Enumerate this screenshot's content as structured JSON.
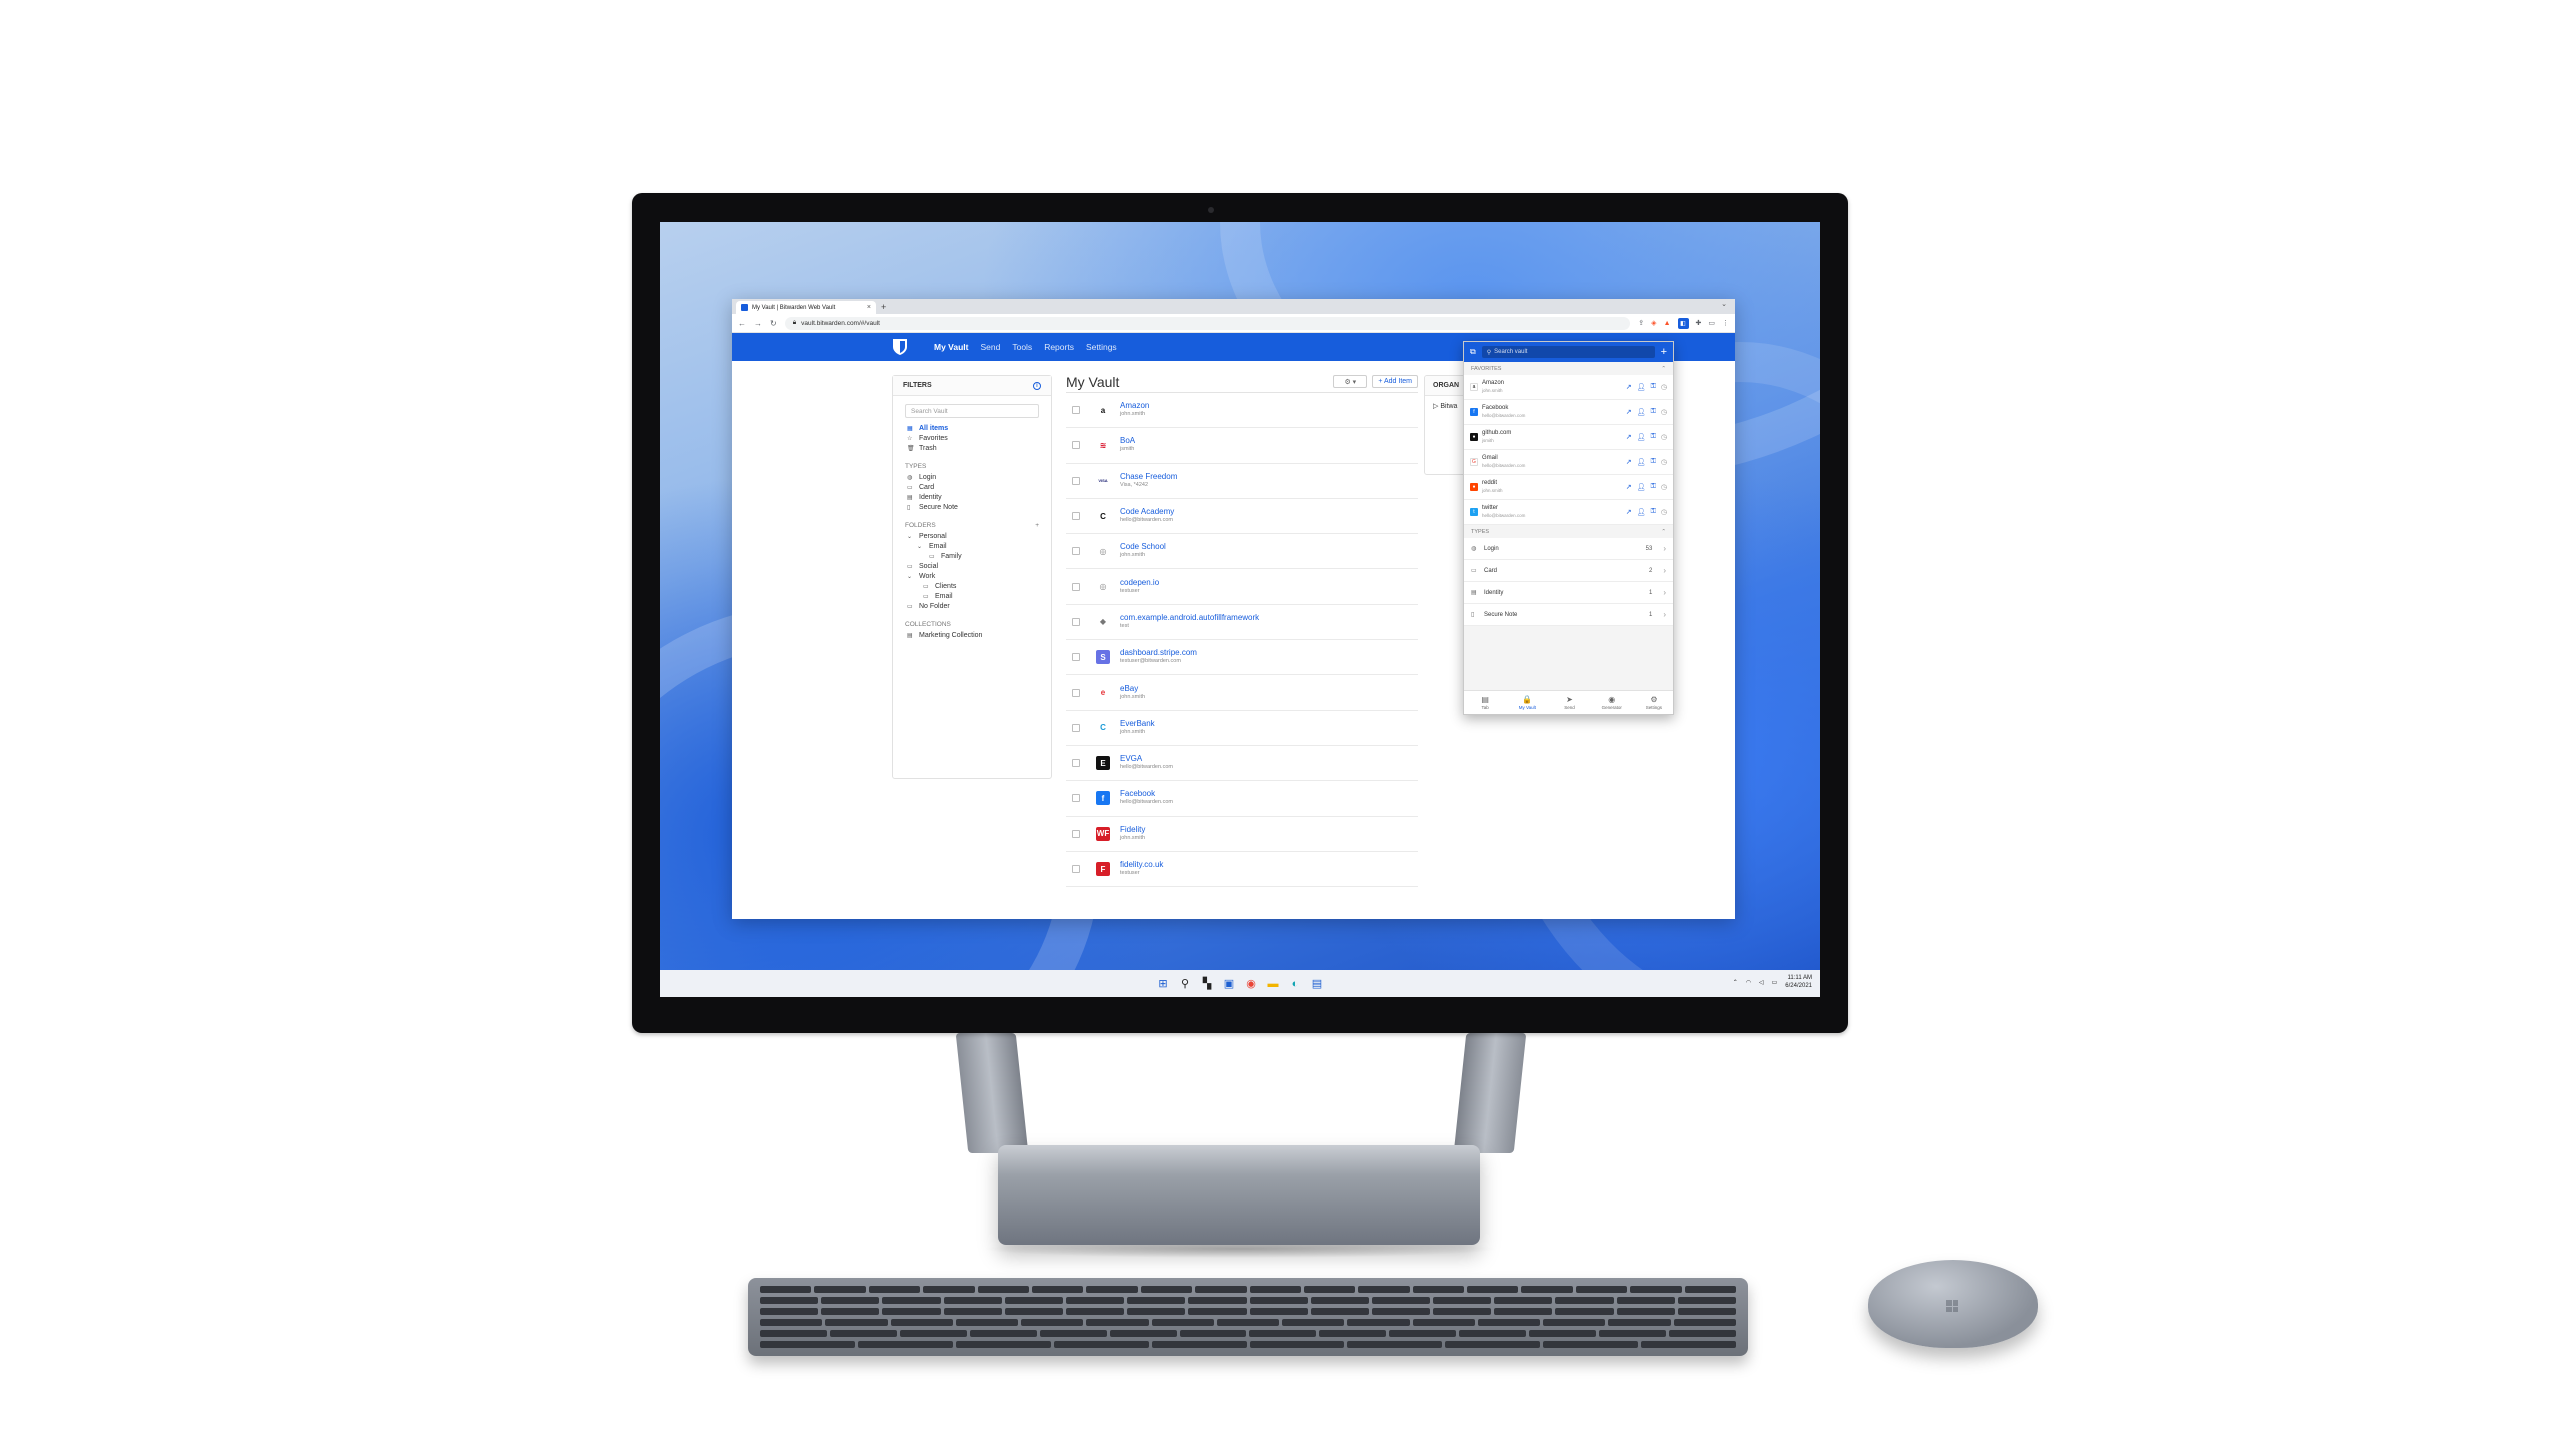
{
  "browser": {
    "tab_title": "My Vault | Bitwarden Web Vault",
    "tab_close": "×",
    "new_tab": "+",
    "url": "vault.bitwarden.com/#/vault"
  },
  "nav": {
    "items": [
      "My Vault",
      "Send",
      "Tools",
      "Reports",
      "Settings"
    ]
  },
  "filters": {
    "title": "FILTERS",
    "search_placeholder": "Search Vault",
    "all_items": "All items",
    "favorites": "Favorites",
    "trash": "Trash",
    "types_label": "TYPES",
    "types": [
      "Login",
      "Card",
      "Identity",
      "Secure Note"
    ],
    "folders_label": "FOLDERS",
    "folders_add": "+",
    "folders": [
      "Personal",
      "Email",
      "Family",
      "Social",
      "Work",
      "Clients",
      "Email",
      "No Folder"
    ],
    "collections_label": "COLLECTIONS",
    "collections": [
      "Marketing Collection"
    ]
  },
  "vault": {
    "title": "My Vault",
    "gear_label": "⚙ ▾",
    "add_item": "+ Add Item",
    "items": [
      {
        "name": "Amazon",
        "sub": "john.smith",
        "icon": "a",
        "icon_bg": "#ffffff",
        "icon_fg": "#111111"
      },
      {
        "name": "BoA",
        "sub": "jsmith",
        "icon": "≋",
        "icon_bg": "#ffffff",
        "icon_fg": "#d4001a"
      },
      {
        "name": "Chase Freedom",
        "sub": "Visa, *4242",
        "icon": "VISA",
        "icon_bg": "#ffffff",
        "icon_fg": "#1a1f71"
      },
      {
        "name": "Code Academy",
        "sub": "hello@bitwarden.com",
        "icon": "C",
        "icon_bg": "#ffffff",
        "icon_fg": "#111111"
      },
      {
        "name": "Code School",
        "sub": "john.smith",
        "icon": "◎",
        "icon_bg": "#ffffff",
        "icon_fg": "#888888"
      },
      {
        "name": "codepen.io",
        "sub": "testuser",
        "icon": "◎",
        "icon_bg": "#ffffff",
        "icon_fg": "#888888"
      },
      {
        "name": "com.example.android.autofillframework",
        "sub": "test",
        "icon": "◆",
        "icon_bg": "#ffffff",
        "icon_fg": "#777777"
      },
      {
        "name": "dashboard.stripe.com",
        "sub": "testuser@bitwarden.com",
        "icon": "S",
        "icon_bg": "#6772e5",
        "icon_fg": "#ffffff"
      },
      {
        "name": "eBay",
        "sub": "john.smith",
        "icon": "e",
        "icon_bg": "#ffffff",
        "icon_fg": "#e53238"
      },
      {
        "name": "EverBank",
        "sub": "john.smith",
        "icon": "C",
        "icon_bg": "#ffffff",
        "icon_fg": "#1a9ad6"
      },
      {
        "name": "EVGA",
        "sub": "hello@bitwarden.com",
        "icon": "E",
        "icon_bg": "#111111",
        "icon_fg": "#ffffff"
      },
      {
        "name": "Facebook",
        "sub": "hello@bitwarden.com",
        "icon": "f",
        "icon_bg": "#1877f2",
        "icon_fg": "#ffffff"
      },
      {
        "name": "Fidelity",
        "sub": "john.smith",
        "icon": "WF",
        "icon_bg": "#d71e28",
        "icon_fg": "#ffffff"
      },
      {
        "name": "fidelity.co.uk",
        "sub": "testuser",
        "icon": "F",
        "icon_bg": "#d71e28",
        "icon_fg": "#ffffff"
      }
    ]
  },
  "organizations": {
    "title": "ORGAN",
    "item": "▷ Bitwa"
  },
  "popup": {
    "search_placeholder": "Search vault",
    "add": "+",
    "favorites_label": "FAVORITES",
    "favorites": [
      {
        "name": "Amazon",
        "sub": "john.smith",
        "icon": "a",
        "color": "#ffffff",
        "fg": "#111111"
      },
      {
        "name": "Facebook",
        "sub": "hello@bitwarden.com",
        "icon": "f",
        "color": "#1877f2",
        "fg": "#ffffff"
      },
      {
        "name": "github.com",
        "sub": "jsmith",
        "icon": "●",
        "color": "#111111",
        "fg": "#ffffff"
      },
      {
        "name": "Gmail",
        "sub": "hello@bitwarden.com",
        "icon": "G",
        "color": "#ffffff",
        "fg": "#ea4335"
      },
      {
        "name": "reddit",
        "sub": "john.smith",
        "icon": "●",
        "color": "#ff4500",
        "fg": "#ffffff"
      },
      {
        "name": "twitter",
        "sub": "hello@bitwarden.com",
        "icon": "t",
        "color": "#1da1f2",
        "fg": "#ffffff"
      }
    ],
    "types_label": "TYPES",
    "types": [
      {
        "name": "Login",
        "count": "53"
      },
      {
        "name": "Card",
        "count": "2"
      },
      {
        "name": "Identity",
        "count": "1"
      },
      {
        "name": "Secure Note",
        "count": "1"
      }
    ],
    "footer": [
      {
        "label": "Tab",
        "icon": "▤"
      },
      {
        "label": "My Vault",
        "icon": "🔒"
      },
      {
        "label": "Send",
        "icon": "➤"
      },
      {
        "label": "Generator",
        "icon": "◉"
      },
      {
        "label": "Settings",
        "icon": "⚙"
      }
    ]
  },
  "taskbar": {
    "time": "11:11 AM",
    "date": "6/24/2021"
  },
  "colors": {
    "brand": "#175ddc"
  }
}
